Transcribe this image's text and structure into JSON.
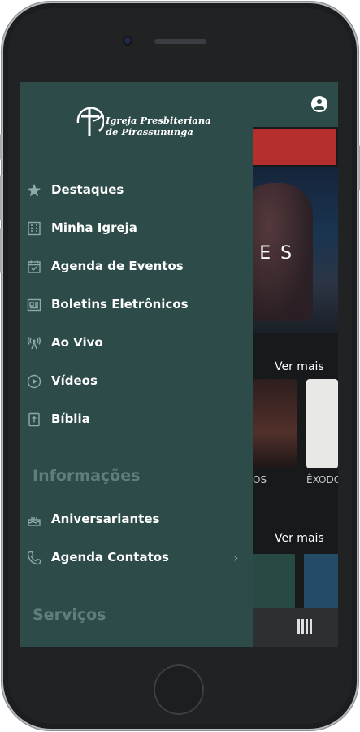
{
  "app": {
    "account_icon": "account-circle-icon",
    "hero_text": "LES",
    "ver_mais_1": "Ver mais",
    "ver_mais_2": "Ver mais",
    "thumb_label_1": "OS",
    "thumb_label_2": "ÊXODO",
    "qr_icon": "qr-code-icon"
  },
  "drawer": {
    "logo_line1": "Igreja Presbiteriana",
    "logo_line2": "de Pirassununga",
    "items": [
      {
        "label": "Destaques",
        "icon": "star-icon"
      },
      {
        "label": "Minha Igreja",
        "icon": "building-icon"
      },
      {
        "label": "Agenda de Eventos",
        "icon": "calendar-check-icon"
      },
      {
        "label": "Boletins Eletrônicos",
        "icon": "newspaper-icon"
      },
      {
        "label": "Ao Vivo",
        "icon": "broadcast-tower-icon"
      },
      {
        "label": "Vídeos",
        "icon": "play-circle-icon"
      },
      {
        "label": "Bíblia",
        "icon": "bible-icon"
      }
    ],
    "section_info": "Informações",
    "info_items": [
      {
        "label": "Aniversariantes",
        "icon": "cake-icon"
      },
      {
        "label": "Agenda Contatos",
        "icon": "phone-icon"
      }
    ],
    "section_services": "Serviços"
  }
}
